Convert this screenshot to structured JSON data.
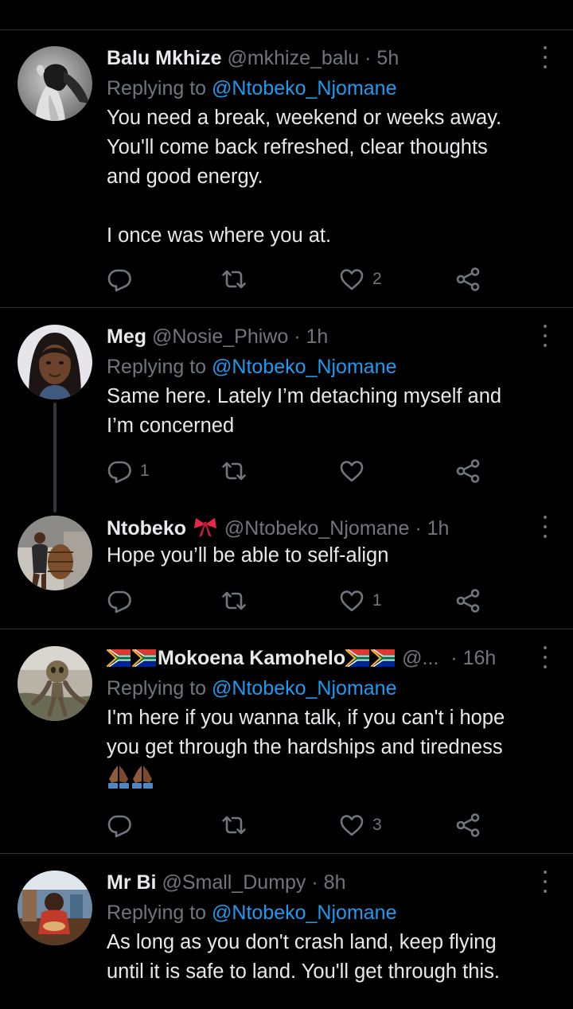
{
  "tweets": [
    {
      "name": "Balu Mkhize",
      "handle": "@mkhize_balu",
      "sep": "·",
      "time": "5h",
      "replying_prefix": "Replying to ",
      "replying_to": "@Ntobeko_Njomane",
      "text": "You need a break, weekend or weeks away.\nYou'll come back refreshed, clear thoughts\nand good energy.\n\nI once was where you at.",
      "replies": "",
      "retweets": "",
      "likes": "2"
    },
    {
      "name": "Meg",
      "handle": "@Nosie_Phiwo",
      "sep": "·",
      "time": "1h",
      "replying_prefix": "Replying to ",
      "replying_to": "@Ntobeko_Njomane",
      "text": "Same here. Lately I’m detaching myself and\nI’m concerned",
      "replies": "1",
      "retweets": "",
      "likes": ""
    },
    {
      "name": "Ntobeko",
      "handle": "@Ntobeko_Njomane",
      "sep": "·",
      "time": "1h",
      "text": "Hope you’ll be able to self-align",
      "replies": "",
      "retweets": "",
      "likes": "1"
    },
    {
      "name": "Mokoena Kamohelo",
      "handle": "@...",
      "sep": "·",
      "time": "16h",
      "replying_prefix": "Replying to ",
      "replying_to": "@Ntobeko_Njomane",
      "text": "I'm here if you wanna talk, if you can't i hope\nyou get through the hardships and tiredness",
      "replies": "",
      "retweets": "",
      "likes": "3"
    },
    {
      "name": "Mr Bi",
      "handle": "@Small_Dumpy",
      "sep": "·",
      "time": "8h",
      "replying_prefix": "Replying to ",
      "replying_to": "@Ntobeko_Njomane",
      "text": "As long as you don't crash land, keep flying\nuntil it is safe to land. You'll get through this."
    }
  ],
  "icons": {
    "reply": "reply-icon",
    "retweet": "retweet-icon",
    "like": "heart-icon",
    "share": "share-icon",
    "more": "more-options-icon",
    "flag": "south-africa-flag-emoji",
    "bow": "ribbon-emoji",
    "pray": "praying-hands-emoji"
  },
  "colors": {
    "background": "#000000",
    "text": "#e7e9ea",
    "secondary": "#71767b",
    "accent": "#1d9bf0",
    "divider": "#2f3336"
  }
}
